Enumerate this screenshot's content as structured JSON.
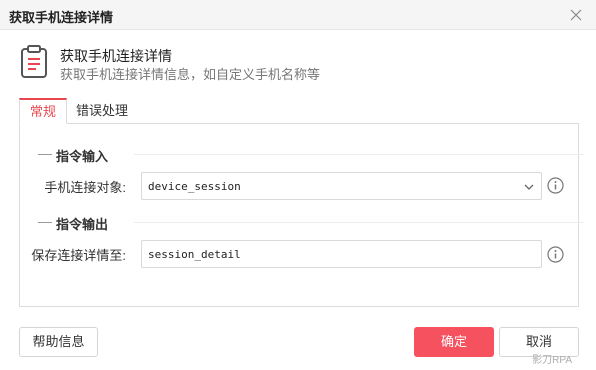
{
  "window": {
    "title": "获取手机连接详情"
  },
  "header": {
    "title": "获取手机连接详情",
    "description": "获取手机连接详情信息，如自定义手机名称等"
  },
  "tabs": [
    {
      "label": "常规",
      "active": true
    },
    {
      "label": "错误处理",
      "active": false
    }
  ],
  "input_section": {
    "title": "指令输入",
    "field_label": "手机连接对象:",
    "field_value": "device_session"
  },
  "output_section": {
    "title": "指令输出",
    "field_label": "保存连接详情至:",
    "field_value": "session_detail"
  },
  "footer": {
    "help_label": "帮助信息",
    "confirm_label": "确定",
    "cancel_label": "取消"
  },
  "watermark": "影刀RPA",
  "colors": {
    "accent": "#e8474f",
    "primary_button": "#f5515f"
  }
}
